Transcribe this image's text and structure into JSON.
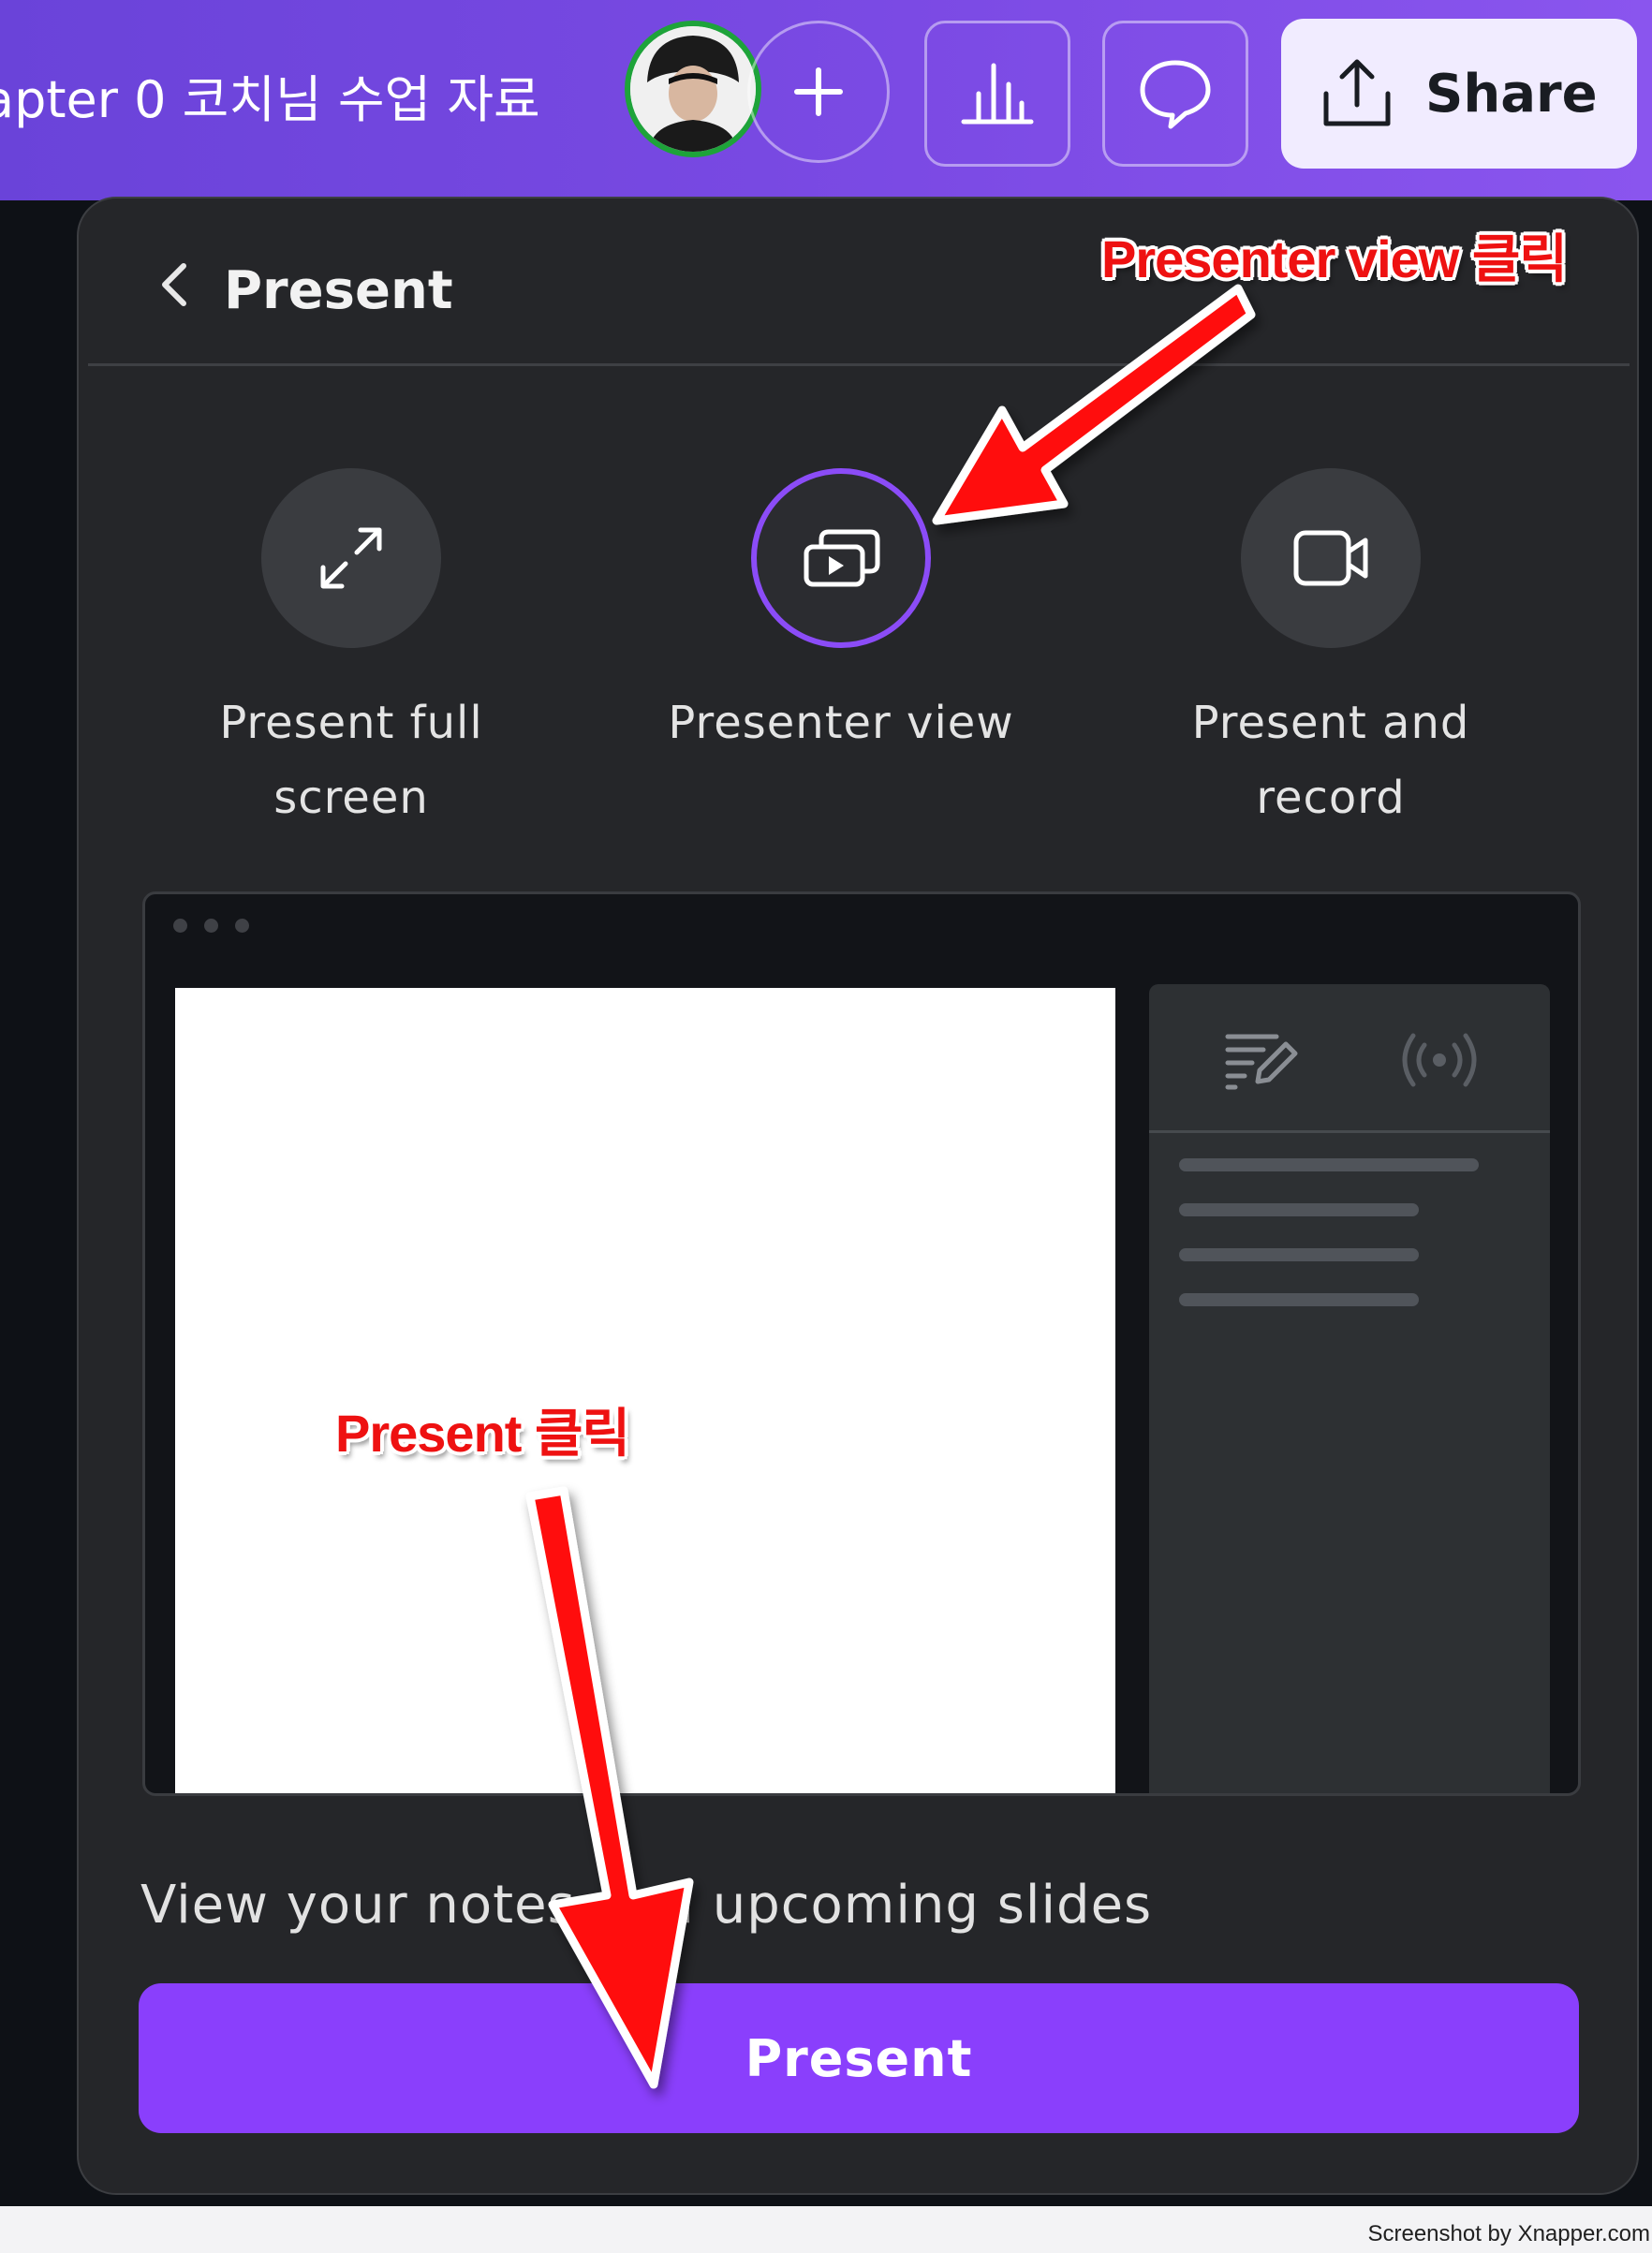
{
  "header": {
    "doc_title": "apter 0 코치님 수업 자료",
    "share_label": "Share",
    "icons": [
      "avatar",
      "plus-icon",
      "insights-bar-chart-icon",
      "comment-icon",
      "share-upload-icon"
    ]
  },
  "panel": {
    "title": "Present",
    "options": [
      {
        "label": "Present full\nscreen",
        "icon": "expand-icon",
        "selected": false
      },
      {
        "label": "Presenter view",
        "icon": "presenter-view-icon",
        "selected": true
      },
      {
        "label": "Present and\nrecord",
        "icon": "video-camera-icon",
        "selected": false
      }
    ],
    "caption": "View your notes and upcoming slides",
    "present_button": "Present"
  },
  "annotations": {
    "presenter_view_click": "Presenter view 클릭",
    "present_click": "Present 클릭",
    "color": "#ee1111"
  },
  "watermark": "Screenshot by Xnapper.com",
  "colors": {
    "accent": "#8a3ffc",
    "topbar_start": "#6a43d9",
    "topbar_end": "#8a55ee",
    "panel_bg": "#252629",
    "avatar_ring": "#1ea33a"
  }
}
